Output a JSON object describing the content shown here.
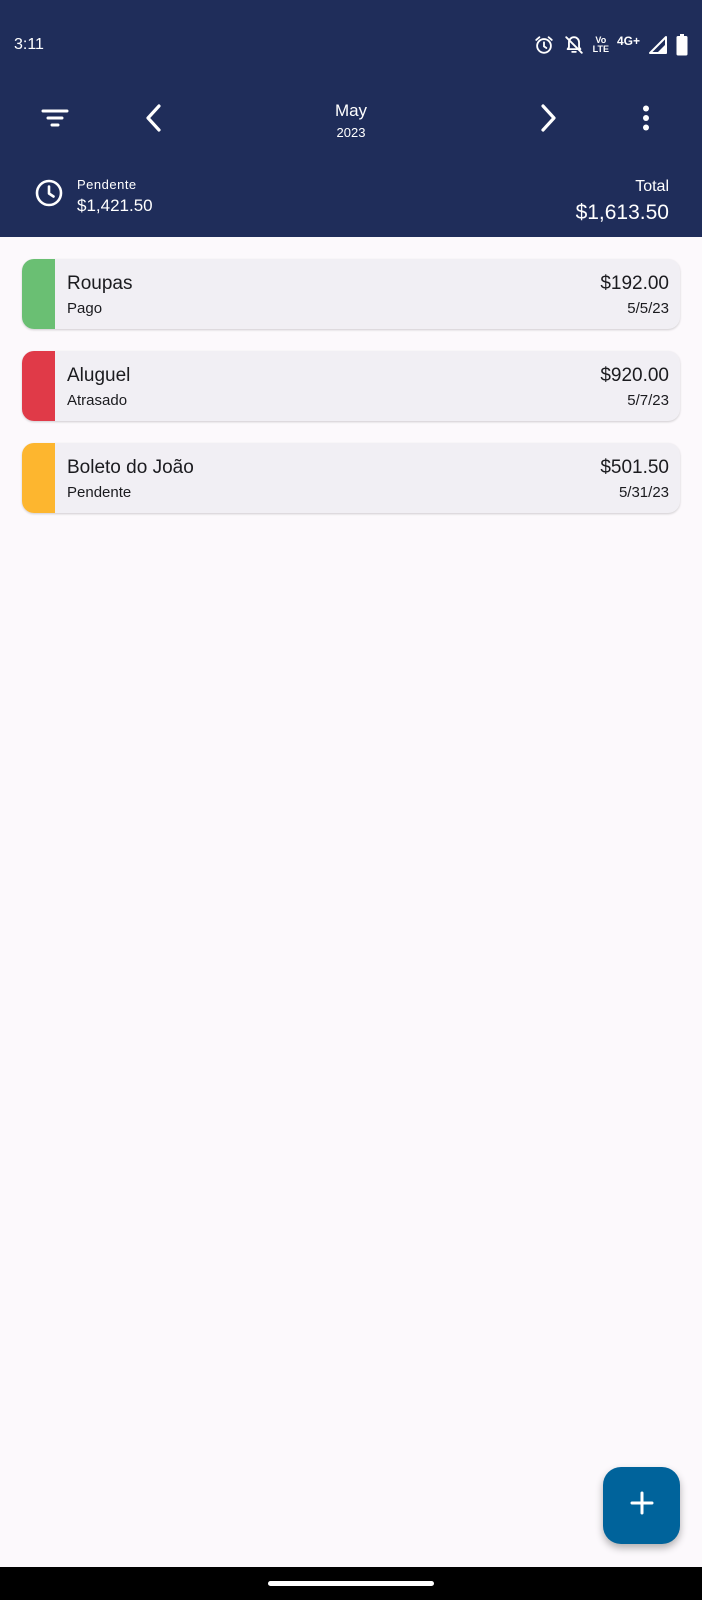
{
  "status_bar": {
    "time": "3:11",
    "volte_top": "Vo",
    "volte_bottom": "LTE",
    "network": "4G+",
    "icons": [
      "alarm-icon",
      "notifications-off-icon",
      "volte-icon",
      "signal-icon",
      "battery-icon"
    ]
  },
  "toolbar": {
    "icons": [
      "filter-icon",
      "chevron-left-icon",
      "chevron-right-icon",
      "more-vert-icon"
    ],
    "month": "May",
    "year": "2023"
  },
  "summary": {
    "pending_icon": "clock-icon",
    "pending_label": "Pendente",
    "pending_value": "$1,421.50",
    "total_label": "Total",
    "total_value": "$1,613.50"
  },
  "bills": [
    {
      "title": "Roupas",
      "status": "Pago",
      "amount": "$192.00",
      "date": "5/5/23",
      "color": "#6abf73"
    },
    {
      "title": "Aluguel",
      "status": "Atrasado",
      "amount": "$920.00",
      "date": "5/7/23",
      "color": "#e03a48"
    },
    {
      "title": "Boleto do João",
      "status": "Pendente",
      "amount": "$501.50",
      "date": "5/31/23",
      "color": "#fdb62f"
    }
  ],
  "fab": {
    "icon": "add-icon"
  },
  "colors": {
    "header": "#1f2d5a",
    "background": "#fcf9fc",
    "card": "#f1eff4",
    "fab": "#00639b"
  }
}
